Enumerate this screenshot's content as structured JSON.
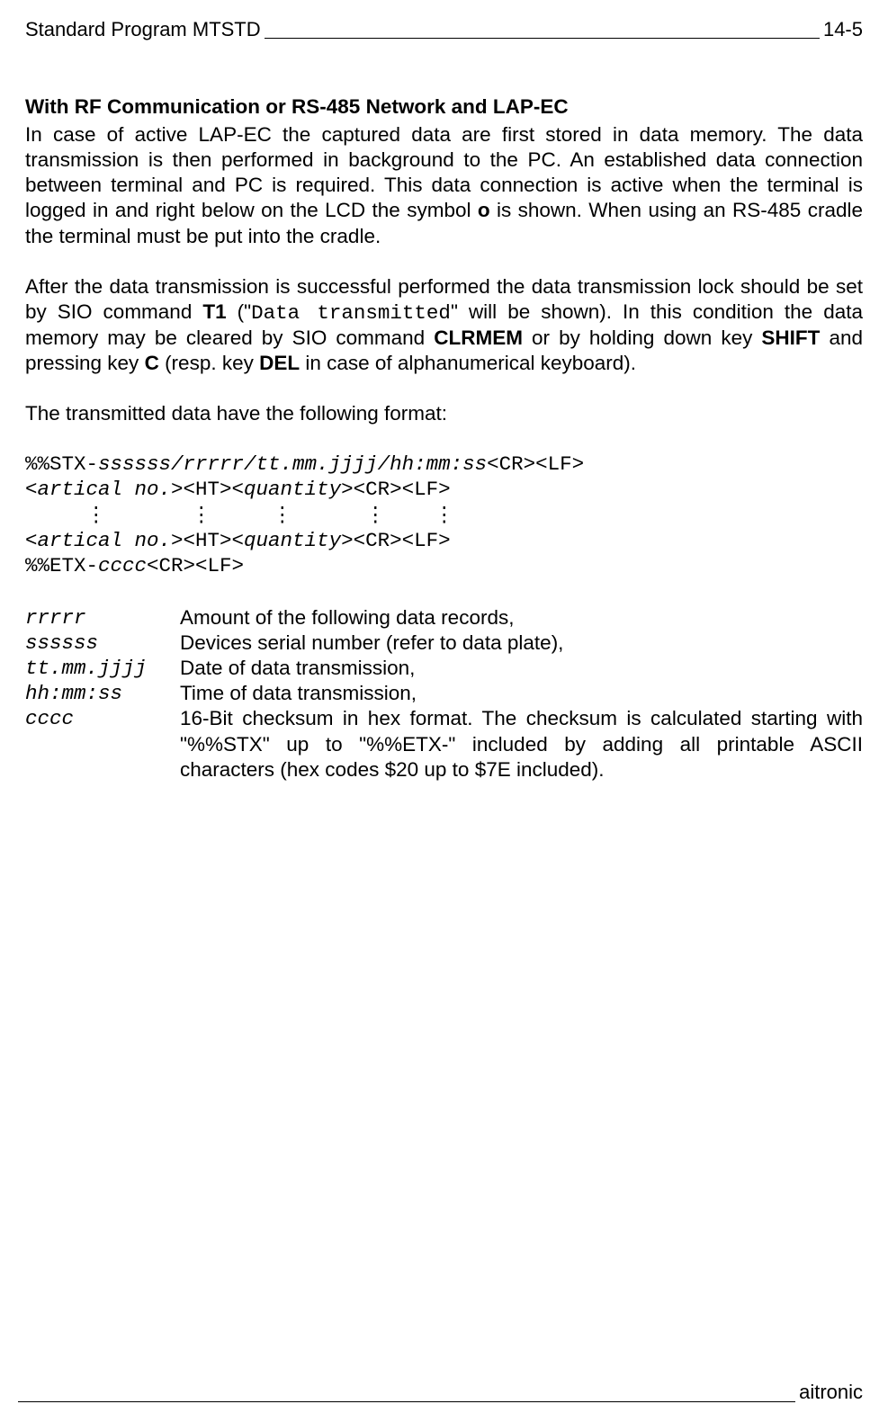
{
  "header": {
    "left": "Standard Program MTSTD",
    "right": "14-5"
  },
  "section_title": "With RF Communication or RS-485 Network and LAP-EC",
  "para1": {
    "t1": "In case of active LAP-EC the captured data are first stored in data memory. The data transmission is then performed in background to the PC. An established data connection between terminal and PC is required. This data connection is active when the terminal is logged in and right below on the LCD the symbol ",
    "b1": "o",
    "t2": " is shown. When using an RS-485 cradle the terminal must be put into the cradle."
  },
  "para2": {
    "t1": "After the data transmission is successful performed the data transmission lock should be set by SIO command ",
    "b1": "T1",
    "t2": " (\"",
    "c1": "Data transmitted",
    "t3": "\" will be shown). In this condition the data memory may be cleared by SIO command ",
    "b2": "CLRMEM",
    "t4": " or by holding down key ",
    "b3": "SHIFT",
    "t5": " and pressing key ",
    "b4": "C",
    "t6": "  (resp. key ",
    "b5": "DEL",
    "t7": " in case of alphanumerical keyboard)."
  },
  "para3": "The transmitted data have the following format:",
  "code": {
    "l1p1": "%%STX-",
    "l1p2": "ssssss/rrrrr/tt.mm.jjjj/hh:mm:ss",
    "l1p3": "<CR><LF>",
    "l2p1": "<artical no.>",
    "l2p2": "<HT>",
    "l2p3": "<quantity>",
    "l2p4": "<CR><LF>",
    "l3": "     ⋮       ⋮     ⋮      ⋮    ⋮",
    "l4p1": "<artical no.>",
    "l4p2": "<HT>",
    "l4p3": "<quantity>",
    "l4p4": "<CR><LF>",
    "l5p1": "%%ETX-",
    "l5p2": "cccc",
    "l5p3": "<CR><LF>"
  },
  "defs": {
    "r1": {
      "term": "rrrrr",
      "desc": "Amount of the following data records,"
    },
    "r2": {
      "term": "ssssss",
      "desc": "Devices serial number (refer to data plate),"
    },
    "r3": {
      "term": "tt.mm.jjjj",
      "desc": "Date of data transmission,"
    },
    "r4": {
      "term": "hh:mm:ss",
      "desc": "Time of data transmission,"
    },
    "r5": {
      "term": "cccc",
      "d1": "16-Bit checksum in hex format. The checksum is calculated starting with \"",
      "c1": "%%STX",
      "d2": "\" up to \"",
      "c2": "%%ETX-",
      "d3": "\" included by adding all printable ASCII characters (hex codes $20 up to $7E included)."
    }
  },
  "footer": {
    "right": "aitronic"
  }
}
